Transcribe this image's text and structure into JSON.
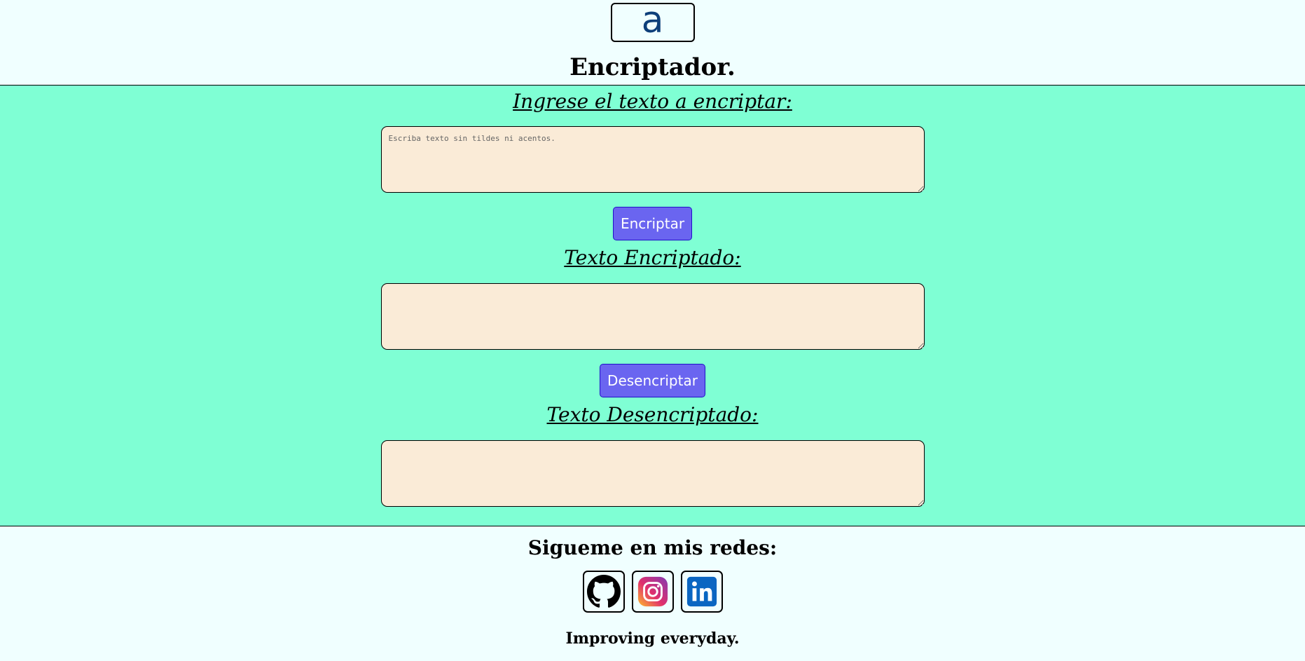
{
  "header": {
    "logo_icon": "letter-a-logo-icon",
    "logo_letter": "a",
    "title": "Encriptador."
  },
  "main": {
    "input_title": "Ingrese el texto a encriptar:",
    "input_placeholder": "Escriba texto sin tildes ni acentos.",
    "input_value": "",
    "encrypt_label": "Encriptar",
    "encrypted_title": "Texto Encriptado:",
    "encrypted_value": "",
    "decrypt_label": "Desencriptar",
    "decrypted_title": "Texto Desencriptado:",
    "decrypted_value": ""
  },
  "footer": {
    "follow_title": "Sigueme en mis redes:",
    "socials": [
      {
        "icon": "github-icon"
      },
      {
        "icon": "instagram-icon"
      },
      {
        "icon": "linkedin-icon"
      }
    ],
    "tagline": "Improving everyday."
  },
  "colors": {
    "page_bg": "#f0ffff",
    "main_bg": "#7fffd4",
    "textarea_bg": "#faebd7",
    "button_bg": "#6a65f0",
    "logo_color": "#0d3f7a",
    "linkedin": "#0a66c2"
  }
}
